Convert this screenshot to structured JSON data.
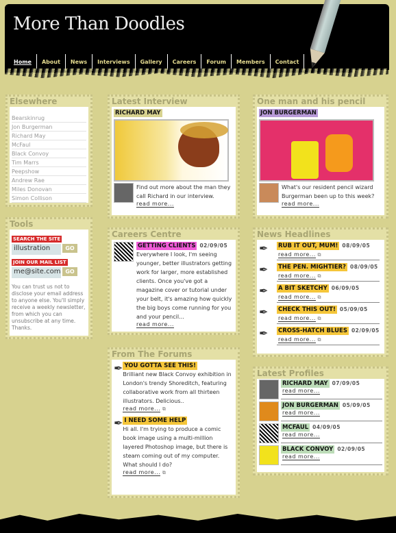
{
  "site": {
    "title": "More Than Doodles"
  },
  "nav": [
    {
      "label": "Home",
      "active": true
    },
    {
      "label": "About"
    },
    {
      "label": "News"
    },
    {
      "label": "Interviews"
    },
    {
      "label": "Gallery"
    },
    {
      "label": "Careers"
    },
    {
      "label": "Forum"
    },
    {
      "label": "Members"
    },
    {
      "label": "Contact"
    }
  ],
  "elsewhere": {
    "heading": "Elsewhere",
    "links": [
      "Bearskinrug",
      "Jon Burgerman",
      "Richard May",
      "McFaul",
      "Black Convoy",
      "Tim Marrs",
      "Peepshow",
      "Andrew Rae",
      "Miles Donovan",
      "Simon Collison"
    ]
  },
  "tools": {
    "heading": "Tools",
    "search_label": "SEARCH THE SITE",
    "search_value": "illustration",
    "go": "GO",
    "mail_label": "JOIN OUR MAIL LIST",
    "mail_value": "me@site.com",
    "note": "You can trust us not to disclose your email address to anyone else. You'll simply receive a weekly newsletter, from which you can unsubscribe at any time. Thanks."
  },
  "interview": {
    "heading": "Latest Interview",
    "name": "RICHARD MAY",
    "text": "Find out more about the man they call Richard in our interview.",
    "more": "read more..."
  },
  "pencil": {
    "heading": "One man and his pencil",
    "name": "JON BURGERMAN",
    "text": "What's our resident pencil wizard Burgerman been up to this week?",
    "more": "read more..."
  },
  "careers": {
    "heading": "Careers Centre",
    "title": "GETTING CLIENTS",
    "date": "02/09/05",
    "text": "Everywhere I look, I'm seeing younger, better illustrators getting work for larger, more established clients. Once you've got a magazine cover or tutorial under your belt, it's amazing how quickly the big boys come running for you and your pencil...",
    "more": "read more..."
  },
  "forums": {
    "heading": "From The Forums",
    "items": [
      {
        "title": "YOU GOTTA SEE THIS!",
        "text": "Brilliant new Black Convoy exhibition in London's trendy Shoreditch, featuring collaborative work from all thirteen illustrators. Delicious..",
        "more": "read more..."
      },
      {
        "title": "I NEED SOME HELP",
        "text": "Hi all. I'm trying to produce a comic book image using a multi-million layered Photoshop image, but there is steam coming out of my computer. What should I do?",
        "more": "read more..."
      }
    ]
  },
  "news": {
    "heading": "News Headlines",
    "items": [
      {
        "title": "RUB IT OUT, MUM!",
        "date": "08/09/05",
        "more": "read more..."
      },
      {
        "title": "THE PEN. MIGHTIER?",
        "date": "08/09/05",
        "more": "read more..."
      },
      {
        "title": "A BIT SKETCHY",
        "date": "06/09/05",
        "more": "read more..."
      },
      {
        "title": "CHECK THIS OUT!",
        "date": "05/09/05",
        "more": "read more..."
      },
      {
        "title": "CROSS-HATCH BLUES",
        "date": "02/09/05",
        "more": "read more..."
      }
    ]
  },
  "profiles": {
    "heading": "Latest Profiles",
    "items": [
      {
        "name": "RICHARD MAY",
        "date": "07/09/05",
        "more": "read more..."
      },
      {
        "name": "JON BURGERMAN",
        "date": "05/09/05",
        "more": "read more..."
      },
      {
        "name": "MCFAUL",
        "date": "04/09/05",
        "more": "read more..."
      },
      {
        "name": "BLACK CONVOY",
        "date": "02/09/05",
        "more": "read more..."
      }
    ]
  },
  "colors": {
    "background": "#d7d28f",
    "news_tag": "#f5c63a",
    "profile_tag": "#bcdcb8",
    "careers_tag": "#f05ad8",
    "interview_tag": "#d7d28f",
    "pencil_tag": "#b89ad8",
    "red_label": "#d62b2b"
  }
}
